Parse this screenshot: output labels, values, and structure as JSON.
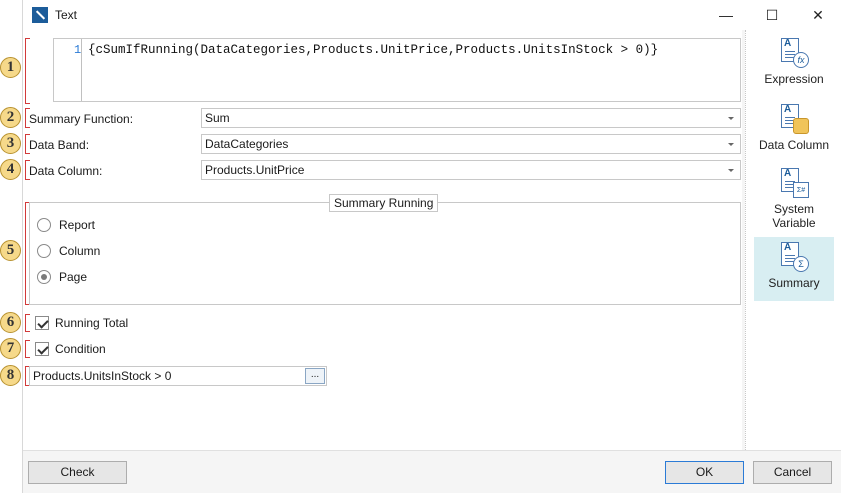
{
  "window": {
    "title": "Text"
  },
  "titlebar_controls": {
    "minimize": "—",
    "maximize": "☐",
    "close": "✕"
  },
  "editor": {
    "line_number": "1",
    "code": "{cSumIfRunning(DataCategories,Products.UnitPrice,Products.UnitsInStock > 0)}"
  },
  "form": {
    "summary_function": {
      "label": "Summary Function:",
      "value": "Sum"
    },
    "data_band": {
      "label": "Data Band:",
      "value": "DataCategories"
    },
    "data_column": {
      "label": "Data Column:",
      "value": "Products.UnitPrice"
    }
  },
  "summary_running": {
    "title": "Summary Running",
    "options": [
      "Report",
      "Column",
      "Page"
    ],
    "selected": "Page"
  },
  "checks": {
    "running_total": {
      "label": "Running Total",
      "checked": true
    },
    "condition": {
      "label": "Condition",
      "checked": true
    }
  },
  "condition_input": {
    "value": "Products.UnitsInStock > 0",
    "button": "..."
  },
  "sidebar": {
    "items": [
      {
        "label": "Expression",
        "icon": "expression-icon",
        "active": false
      },
      {
        "label": "Data Column",
        "icon": "data-column-icon",
        "active": false
      },
      {
        "label": "System Variable",
        "icon": "system-variable-icon",
        "active": false
      },
      {
        "label": "Summary",
        "icon": "summary-icon",
        "active": true
      }
    ]
  },
  "footer": {
    "check": "Check",
    "ok": "OK",
    "cancel": "Cancel"
  },
  "markers": [
    "1",
    "2",
    "3",
    "4",
    "5",
    "6",
    "7",
    "8"
  ]
}
